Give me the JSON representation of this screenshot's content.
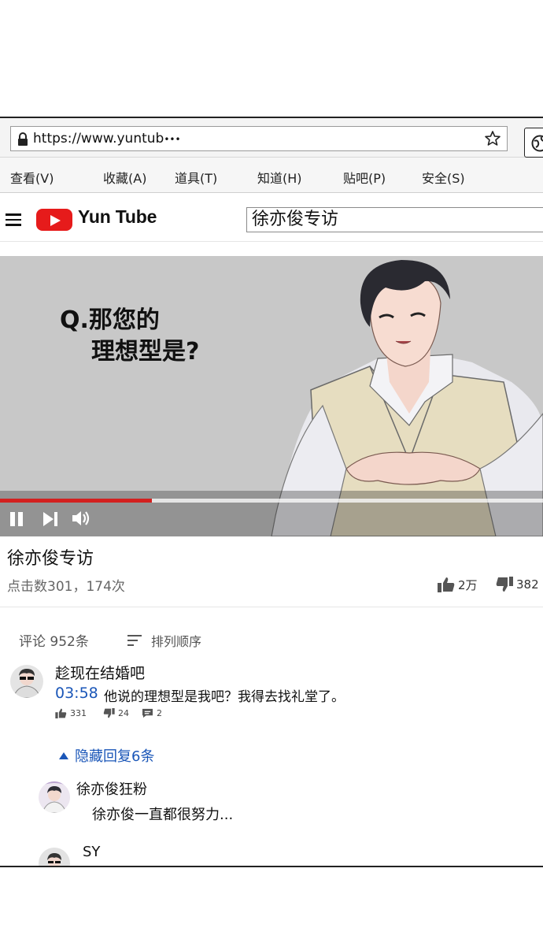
{
  "browser": {
    "url": "https://www.yuntub",
    "url_overflow": "•••"
  },
  "menu": {
    "items": [
      "查看(V)",
      "收藏(A)",
      "道具(T)",
      "知道(H)",
      "贴吧(P)",
      "安全(S)"
    ]
  },
  "site": {
    "logo_text": "Yun Tube",
    "search_value": "徐亦俊专访",
    "brand_color": "#e61b1b"
  },
  "video": {
    "question_line1": "Q.那您的",
    "question_line2": "理想型是?",
    "progress": 0.28,
    "title": "徐亦俊专访",
    "views": "点击数301，174次",
    "likes": "2万",
    "dislikes": "382"
  },
  "comments": {
    "header": "评论 952条",
    "sort_label": "排列顺序",
    "top_comment": {
      "author": "趁现在结婚吧",
      "timestamp": "03:58",
      "text": "他说的理想型是我吧？我得去找礼堂了。",
      "likes": "331",
      "dislikes": "24",
      "replies": "2"
    },
    "toggle_replies": "隐藏回复6条",
    "replies": [
      {
        "author": "徐亦俊狂粉",
        "text": "徐亦俊一直都很努力..."
      },
      {
        "author": "SY"
      }
    ],
    "link_color": "#1a56b8"
  }
}
